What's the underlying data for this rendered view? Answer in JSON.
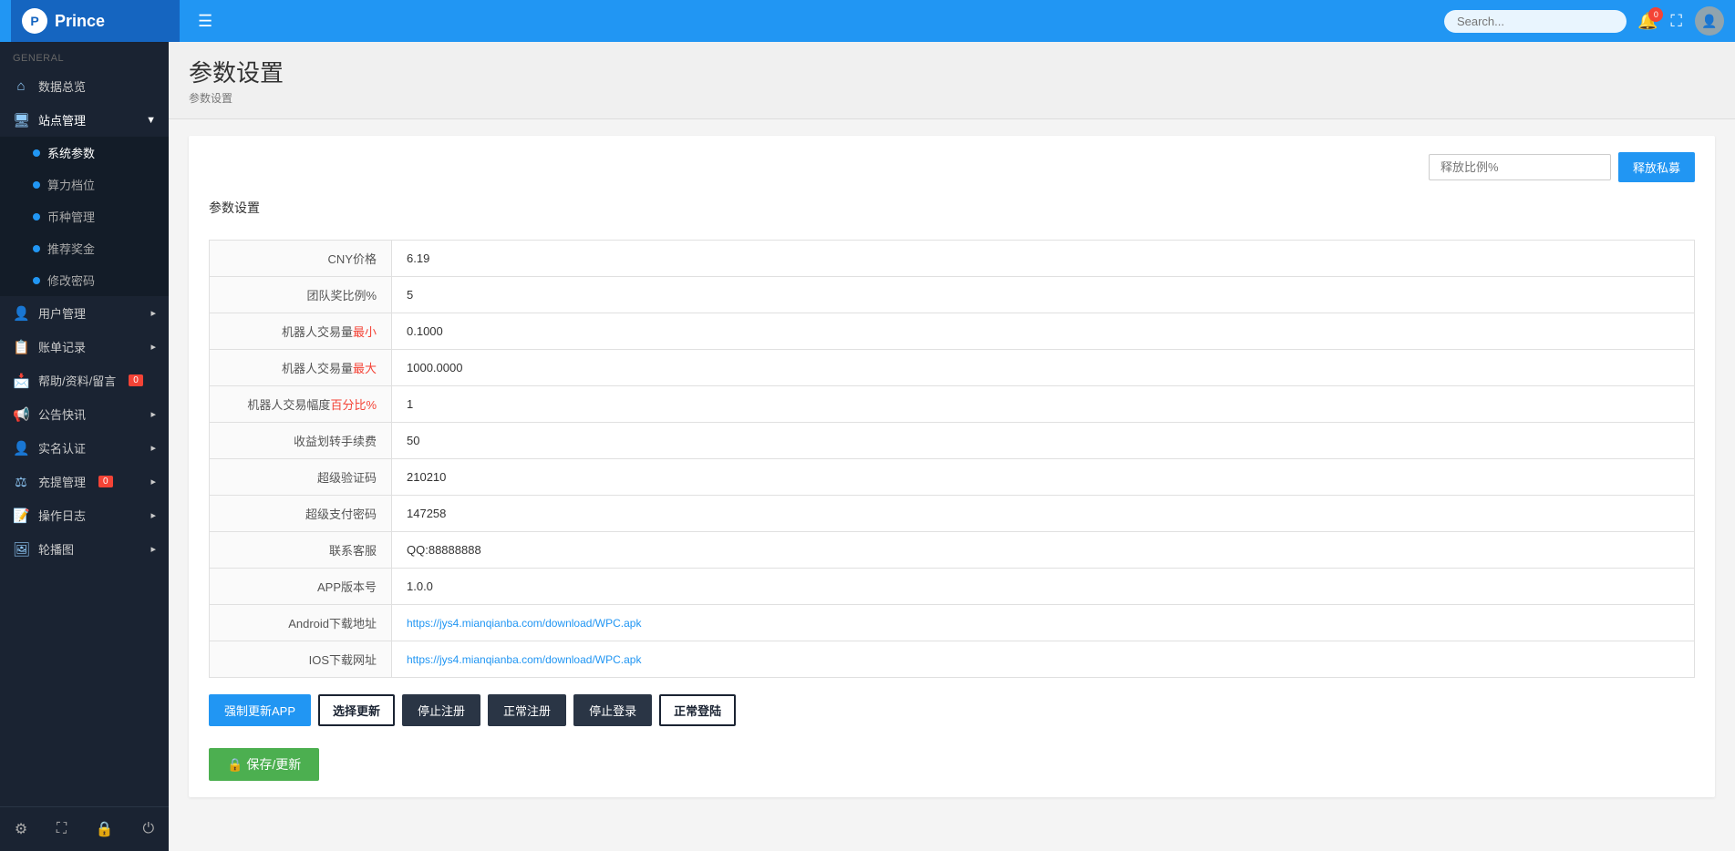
{
  "brand": {
    "logo_letter": "P",
    "name": "Prince"
  },
  "navbar": {
    "toggle_icon": "☰",
    "search_placeholder": "Search...",
    "bell_badge": "0",
    "expand_icon": "⛶"
  },
  "sidebar": {
    "section_label": "GENERAL",
    "items": [
      {
        "id": "dashboard",
        "icon": "⌂",
        "label": "数据总览"
      },
      {
        "id": "site-management",
        "icon": "🖥",
        "label": "站点管理",
        "has_arrow": true,
        "expanded": true,
        "subitems": [
          {
            "id": "system-params",
            "label": "系统参数",
            "active": true
          },
          {
            "id": "hashrate-level",
            "label": "算力档位"
          },
          {
            "id": "currency-management",
            "label": "币种管理"
          },
          {
            "id": "referral-reward",
            "label": "推荐奖金"
          },
          {
            "id": "change-password",
            "label": "修改密码"
          }
        ]
      },
      {
        "id": "user-management",
        "icon": "👤",
        "label": "用户管理▸"
      },
      {
        "id": "account-records",
        "icon": "📋",
        "label": "账单记录▸"
      },
      {
        "id": "help-messages",
        "icon": "📩",
        "label": "帮助/资料/留言",
        "badge": "0"
      },
      {
        "id": "announcements",
        "icon": "📢",
        "label": "公告快讯▸"
      },
      {
        "id": "real-name-auth",
        "icon": "👤",
        "label": "实名认证▸"
      },
      {
        "id": "recharge-management",
        "icon": "⚖",
        "label": "充提管理",
        "badge": "0"
      },
      {
        "id": "operation-logs",
        "icon": "📝",
        "label": "操作日志▸"
      },
      {
        "id": "carousel",
        "icon": "🖼",
        "label": "轮播图▸"
      }
    ],
    "bottom_icons": [
      "⚙",
      "⛶",
      "🔒",
      "⏻"
    ]
  },
  "page": {
    "title": "参数设置",
    "breadcrumb": "参数设置"
  },
  "release_section": {
    "input_placeholder": "释放比例%",
    "button_label": "释放私募"
  },
  "params_section_label": "参数设置",
  "form_fields": [
    {
      "id": "cny-price",
      "label": "CNY价格",
      "value": "6.19",
      "label_suffix": ""
    },
    {
      "id": "team-ratio",
      "label": "团队奖比例%",
      "value": "5",
      "label_suffix": ""
    },
    {
      "id": "robot-min",
      "label": "机器人交易量",
      "label_red": "最小",
      "value": "0.1000"
    },
    {
      "id": "robot-max",
      "label": "机器人交易量",
      "label_red": "最大",
      "value": "1000.0000"
    },
    {
      "id": "robot-range",
      "label": "机器人交易幅度",
      "label_red": "百分比%",
      "value": "1"
    },
    {
      "id": "transfer-fee",
      "label": "收益划转手续费",
      "value": "50",
      "label_suffix": ""
    },
    {
      "id": "super-verify",
      "label": "超级验证码",
      "value": "210210",
      "label_suffix": ""
    },
    {
      "id": "super-pay-pwd",
      "label": "超级支付密码",
      "value": "147258",
      "label_suffix": ""
    },
    {
      "id": "customer-service",
      "label": "联系客服",
      "value": "QQ:88888888",
      "label_suffix": ""
    },
    {
      "id": "app-version",
      "label": "APP版本号",
      "value": "1.0.0",
      "label_suffix": ""
    },
    {
      "id": "android-url",
      "label": "Android下载地址",
      "value": "https://jys4.mianqianba.com/download/WPC.apk",
      "is_link": true
    },
    {
      "id": "ios-url",
      "label": "IOS下载网址",
      "value": "https://jys4.mianqianba.com/download/WPC.apk",
      "is_link": true
    }
  ],
  "action_buttons": [
    {
      "id": "force-update",
      "label": "强制更新APP",
      "style": "primary"
    },
    {
      "id": "select-update",
      "label": "选择更新",
      "style": "outline-dark"
    },
    {
      "id": "stop-register",
      "label": "停止注册",
      "style": "dark"
    },
    {
      "id": "normal-register",
      "label": "正常注册",
      "style": "dark"
    },
    {
      "id": "stop-login",
      "label": "停止登录",
      "style": "dark"
    },
    {
      "id": "normal-login",
      "label": "正常登陆",
      "style": "outline-dark"
    }
  ],
  "save_button_label": "🔒 保存/更新"
}
